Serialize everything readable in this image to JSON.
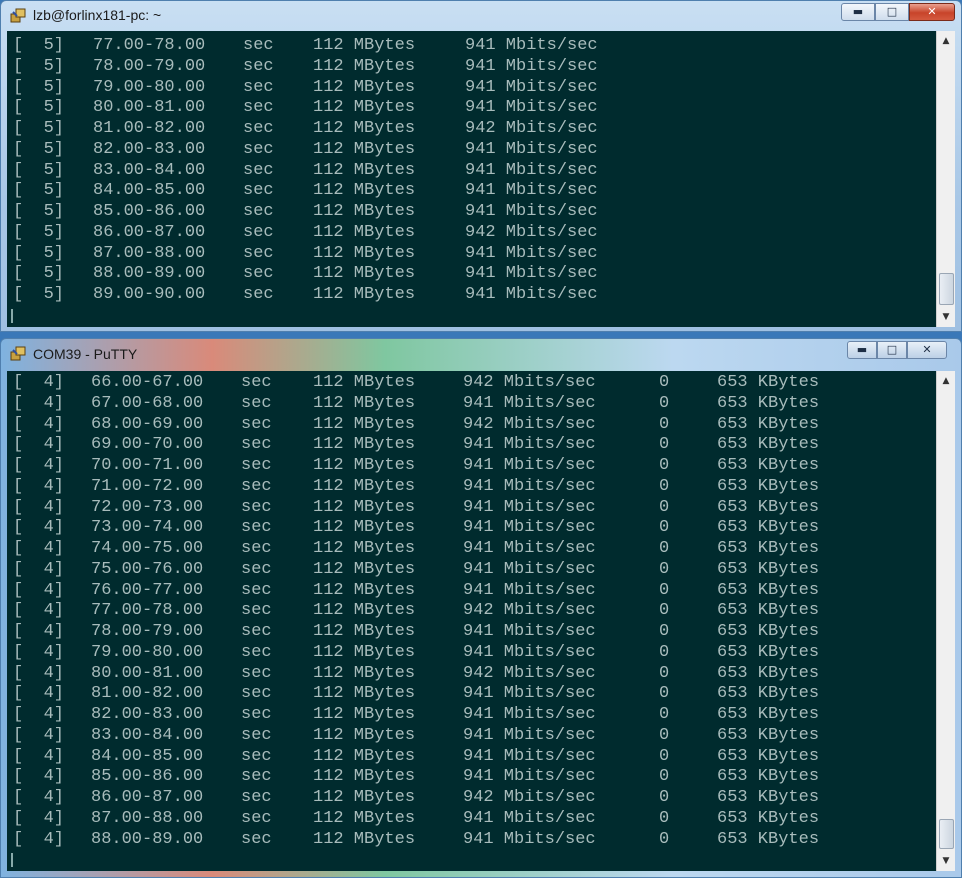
{
  "windows": [
    {
      "title": "lzb@forlinx181-pc: ~",
      "rows": [
        {
          "id": "[  5]",
          "interval": "77.00-78.00",
          "unit": "sec",
          "transfer": "112 MBytes",
          "bandwidth": "941 Mbits/sec"
        },
        {
          "id": "[  5]",
          "interval": "78.00-79.00",
          "unit": "sec",
          "transfer": "112 MBytes",
          "bandwidth": "941 Mbits/sec"
        },
        {
          "id": "[  5]",
          "interval": "79.00-80.00",
          "unit": "sec",
          "transfer": "112 MBytes",
          "bandwidth": "941 Mbits/sec"
        },
        {
          "id": "[  5]",
          "interval": "80.00-81.00",
          "unit": "sec",
          "transfer": "112 MBytes",
          "bandwidth": "941 Mbits/sec"
        },
        {
          "id": "[  5]",
          "interval": "81.00-82.00",
          "unit": "sec",
          "transfer": "112 MBytes",
          "bandwidth": "942 Mbits/sec"
        },
        {
          "id": "[  5]",
          "interval": "82.00-83.00",
          "unit": "sec",
          "transfer": "112 MBytes",
          "bandwidth": "941 Mbits/sec"
        },
        {
          "id": "[  5]",
          "interval": "83.00-84.00",
          "unit": "sec",
          "transfer": "112 MBytes",
          "bandwidth": "941 Mbits/sec"
        },
        {
          "id": "[  5]",
          "interval": "84.00-85.00",
          "unit": "sec",
          "transfer": "112 MBytes",
          "bandwidth": "941 Mbits/sec"
        },
        {
          "id": "[  5]",
          "interval": "85.00-86.00",
          "unit": "sec",
          "transfer": "112 MBytes",
          "bandwidth": "941 Mbits/sec"
        },
        {
          "id": "[  5]",
          "interval": "86.00-87.00",
          "unit": "sec",
          "transfer": "112 MBytes",
          "bandwidth": "942 Mbits/sec"
        },
        {
          "id": "[  5]",
          "interval": "87.00-88.00",
          "unit": "sec",
          "transfer": "112 MBytes",
          "bandwidth": "941 Mbits/sec"
        },
        {
          "id": "[  5]",
          "interval": "88.00-89.00",
          "unit": "sec",
          "transfer": "112 MBytes",
          "bandwidth": "941 Mbits/sec"
        },
        {
          "id": "[  5]",
          "interval": "89.00-90.00",
          "unit": "sec",
          "transfer": "112 MBytes",
          "bandwidth": "941 Mbits/sec"
        }
      ]
    },
    {
      "title": "COM39 - PuTTY",
      "rows": [
        {
          "id": "[  4]",
          "interval": "66.00-67.00",
          "unit": "sec",
          "transfer": "112 MBytes",
          "bandwidth": "942 Mbits/sec",
          "retr": "0",
          "cwnd": "653 KBytes"
        },
        {
          "id": "[  4]",
          "interval": "67.00-68.00",
          "unit": "sec",
          "transfer": "112 MBytes",
          "bandwidth": "941 Mbits/sec",
          "retr": "0",
          "cwnd": "653 KBytes"
        },
        {
          "id": "[  4]",
          "interval": "68.00-69.00",
          "unit": "sec",
          "transfer": "112 MBytes",
          "bandwidth": "942 Mbits/sec",
          "retr": "0",
          "cwnd": "653 KBytes"
        },
        {
          "id": "[  4]",
          "interval": "69.00-70.00",
          "unit": "sec",
          "transfer": "112 MBytes",
          "bandwidth": "941 Mbits/sec",
          "retr": "0",
          "cwnd": "653 KBytes"
        },
        {
          "id": "[  4]",
          "interval": "70.00-71.00",
          "unit": "sec",
          "transfer": "112 MBytes",
          "bandwidth": "941 Mbits/sec",
          "retr": "0",
          "cwnd": "653 KBytes"
        },
        {
          "id": "[  4]",
          "interval": "71.00-72.00",
          "unit": "sec",
          "transfer": "112 MBytes",
          "bandwidth": "941 Mbits/sec",
          "retr": "0",
          "cwnd": "653 KBytes"
        },
        {
          "id": "[  4]",
          "interval": "72.00-73.00",
          "unit": "sec",
          "transfer": "112 MBytes",
          "bandwidth": "941 Mbits/sec",
          "retr": "0",
          "cwnd": "653 KBytes"
        },
        {
          "id": "[  4]",
          "interval": "73.00-74.00",
          "unit": "sec",
          "transfer": "112 MBytes",
          "bandwidth": "941 Mbits/sec",
          "retr": "0",
          "cwnd": "653 KBytes"
        },
        {
          "id": "[  4]",
          "interval": "74.00-75.00",
          "unit": "sec",
          "transfer": "112 MBytes",
          "bandwidth": "941 Mbits/sec",
          "retr": "0",
          "cwnd": "653 KBytes"
        },
        {
          "id": "[  4]",
          "interval": "75.00-76.00",
          "unit": "sec",
          "transfer": "112 MBytes",
          "bandwidth": "941 Mbits/sec",
          "retr": "0",
          "cwnd": "653 KBytes"
        },
        {
          "id": "[  4]",
          "interval": "76.00-77.00",
          "unit": "sec",
          "transfer": "112 MBytes",
          "bandwidth": "941 Mbits/sec",
          "retr": "0",
          "cwnd": "653 KBytes"
        },
        {
          "id": "[  4]",
          "interval": "77.00-78.00",
          "unit": "sec",
          "transfer": "112 MBytes",
          "bandwidth": "942 Mbits/sec",
          "retr": "0",
          "cwnd": "653 KBytes"
        },
        {
          "id": "[  4]",
          "interval": "78.00-79.00",
          "unit": "sec",
          "transfer": "112 MBytes",
          "bandwidth": "941 Mbits/sec",
          "retr": "0",
          "cwnd": "653 KBytes"
        },
        {
          "id": "[  4]",
          "interval": "79.00-80.00",
          "unit": "sec",
          "transfer": "112 MBytes",
          "bandwidth": "941 Mbits/sec",
          "retr": "0",
          "cwnd": "653 KBytes"
        },
        {
          "id": "[  4]",
          "interval": "80.00-81.00",
          "unit": "sec",
          "transfer": "112 MBytes",
          "bandwidth": "942 Mbits/sec",
          "retr": "0",
          "cwnd": "653 KBytes"
        },
        {
          "id": "[  4]",
          "interval": "81.00-82.00",
          "unit": "sec",
          "transfer": "112 MBytes",
          "bandwidth": "941 Mbits/sec",
          "retr": "0",
          "cwnd": "653 KBytes"
        },
        {
          "id": "[  4]",
          "interval": "82.00-83.00",
          "unit": "sec",
          "transfer": "112 MBytes",
          "bandwidth": "941 Mbits/sec",
          "retr": "0",
          "cwnd": "653 KBytes"
        },
        {
          "id": "[  4]",
          "interval": "83.00-84.00",
          "unit": "sec",
          "transfer": "112 MBytes",
          "bandwidth": "941 Mbits/sec",
          "retr": "0",
          "cwnd": "653 KBytes"
        },
        {
          "id": "[  4]",
          "interval": "84.00-85.00",
          "unit": "sec",
          "transfer": "112 MBytes",
          "bandwidth": "941 Mbits/sec",
          "retr": "0",
          "cwnd": "653 KBytes"
        },
        {
          "id": "[  4]",
          "interval": "85.00-86.00",
          "unit": "sec",
          "transfer": "112 MBytes",
          "bandwidth": "941 Mbits/sec",
          "retr": "0",
          "cwnd": "653 KBytes"
        },
        {
          "id": "[  4]",
          "interval": "86.00-87.00",
          "unit": "sec",
          "transfer": "112 MBytes",
          "bandwidth": "942 Mbits/sec",
          "retr": "0",
          "cwnd": "653 KBytes"
        },
        {
          "id": "[  4]",
          "interval": "87.00-88.00",
          "unit": "sec",
          "transfer": "112 MBytes",
          "bandwidth": "941 Mbits/sec",
          "retr": "0",
          "cwnd": "653 KBytes"
        },
        {
          "id": "[  4]",
          "interval": "88.00-89.00",
          "unit": "sec",
          "transfer": "112 MBytes",
          "bandwidth": "941 Mbits/sec",
          "retr": "0",
          "cwnd": "653 KBytes"
        }
      ]
    }
  ],
  "controls": {
    "minimize": "▬",
    "maximize": "□",
    "close": "✕"
  },
  "icons": {
    "app": "putty-icon",
    "min": "minimize-icon",
    "max": "maximize-icon",
    "close": "close-icon"
  },
  "colors": {
    "terminal_bg": "#002b2e",
    "terminal_fg": "#a8bcbc"
  }
}
